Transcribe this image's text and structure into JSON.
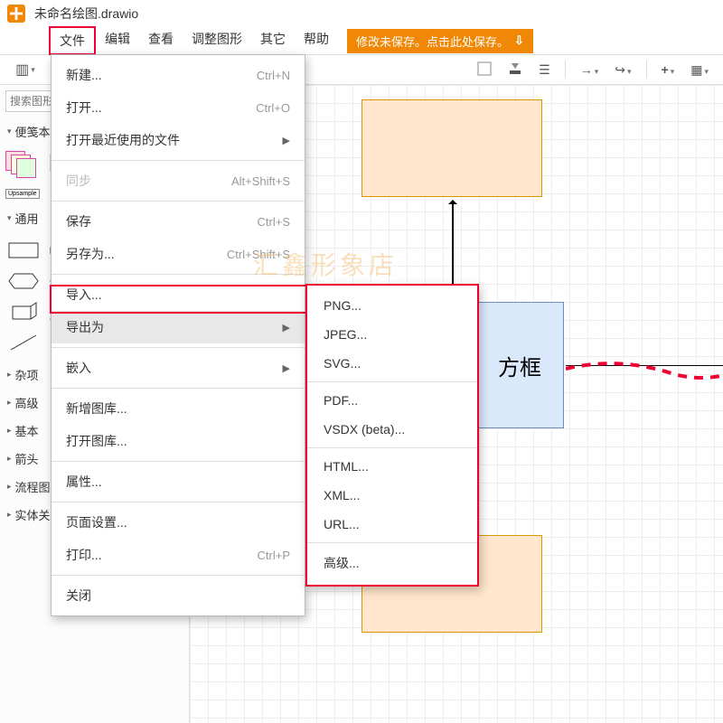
{
  "title": "未命名绘图.drawio",
  "menubar": [
    "文件",
    "编辑",
    "查看",
    "调整图形",
    "其它",
    "帮助"
  ],
  "save_warning": "修改未保存。点击此处保存。",
  "search_placeholder": "搜索图形",
  "sidebar_sections": {
    "scratch": "便笺本",
    "general": "通用",
    "misc": "杂项",
    "advanced": "高级",
    "basic": "基本",
    "arrows": "箭头",
    "flow": "流程图",
    "er": "实体关系"
  },
  "file_menu": [
    {
      "label": "新建...",
      "shortcut": "Ctrl+N"
    },
    {
      "label": "打开...",
      "shortcut": "Ctrl+O"
    },
    {
      "label": "打开最近使用的文件",
      "submenu": true
    },
    {
      "sep": true
    },
    {
      "label": "同步",
      "shortcut": "Alt+Shift+S",
      "disabled": true
    },
    {
      "sep": true
    },
    {
      "label": "保存",
      "shortcut": "Ctrl+S"
    },
    {
      "label": "另存为...",
      "shortcut": "Ctrl+Shift+S"
    },
    {
      "sep": true
    },
    {
      "label": "导入..."
    },
    {
      "label": "导出为",
      "submenu": true,
      "hover": true
    },
    {
      "sep": true
    },
    {
      "label": "嵌入",
      "submenu": true
    },
    {
      "sep": true
    },
    {
      "label": "新增图库..."
    },
    {
      "label": "打开图库..."
    },
    {
      "sep": true
    },
    {
      "label": "属性..."
    },
    {
      "sep": true
    },
    {
      "label": "页面设置..."
    },
    {
      "label": "打印...",
      "shortcut": "Ctrl+P"
    },
    {
      "sep": true
    },
    {
      "label": "关闭"
    }
  ],
  "export_menu": [
    "PNG...",
    "JPEG...",
    "SVG...",
    "",
    "PDF...",
    "VSDX (beta)...",
    "",
    "HTML...",
    "XML...",
    "URL...",
    "",
    "高级..."
  ],
  "canvas": {
    "box_label": "方框"
  },
  "watermark": "汇鑫形象店"
}
